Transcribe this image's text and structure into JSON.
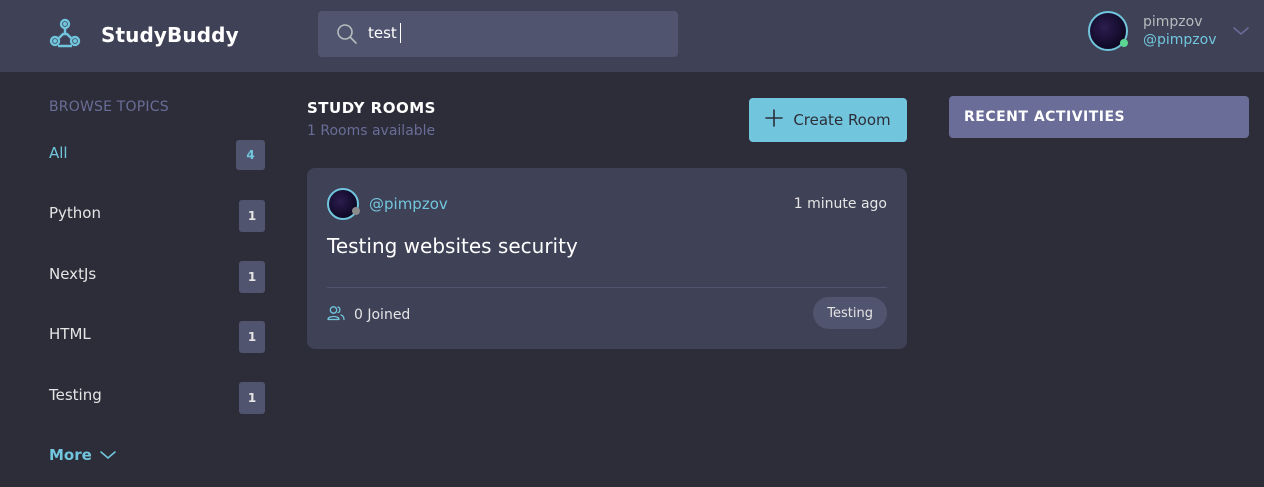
{
  "app": {
    "name": "StudyBuddy"
  },
  "search": {
    "value": "test",
    "placeholder": ""
  },
  "user": {
    "name": "pimpzov",
    "handle": "@pimpzov"
  },
  "topics": {
    "title": "BROWSE TOPICS",
    "items": [
      {
        "label": "All",
        "count": "4",
        "active": true
      },
      {
        "label": "Python",
        "count": "1"
      },
      {
        "label": "NextJs",
        "count": "1"
      },
      {
        "label": "HTML",
        "count": "1"
      },
      {
        "label": "Testing",
        "count": "1"
      }
    ],
    "more_label": "More"
  },
  "rooms": {
    "title": "STUDY ROOMS",
    "subtitle": "1 Rooms available",
    "create_label": "Create Room",
    "list": [
      {
        "author": "@pimpzov",
        "time": "1 minute ago",
        "title": "Testing websites security",
        "joined": "0 Joined",
        "topic": "Testing"
      }
    ]
  },
  "activities": {
    "title": "RECENT ACTIVITIES"
  },
  "colors": {
    "background": "#2d2d39",
    "header": "#3f4156",
    "accent": "#71c6dd",
    "muted": "#696d97",
    "online": "#5dd693"
  },
  "icons": [
    "logo-icon",
    "search-icon",
    "chevron-down-icon",
    "plus-icon",
    "users-icon"
  ]
}
